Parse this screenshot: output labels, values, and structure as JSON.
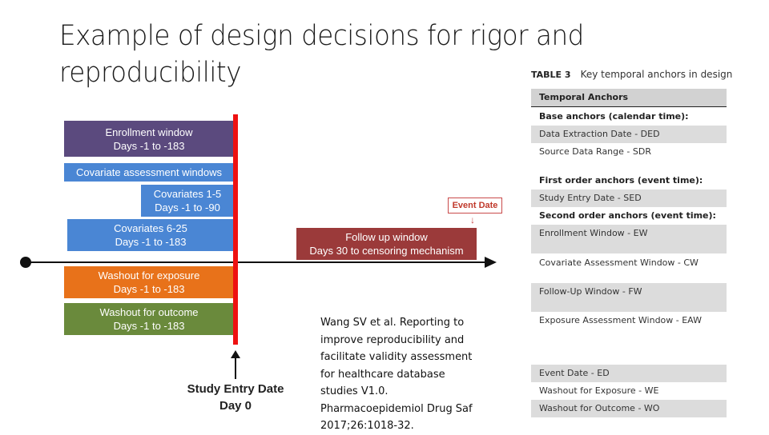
{
  "slide": {
    "title": "Example of design decisions for rigor and reproducibility"
  },
  "diagram": {
    "bars": [
      {
        "id": "enrollment",
        "line1": "Enrollment window",
        "line2": "Days -1 to -183",
        "color": "#5b4a7e"
      },
      {
        "id": "covariate-assessment",
        "line1": "Covariate assessment windows",
        "line2": "",
        "color": "#4a86d4"
      },
      {
        "id": "covariates-1-5",
        "line1": "Covariates 1-5",
        "line2": "Days -1 to -90",
        "color": "#4a86d4"
      },
      {
        "id": "covariates-6-25",
        "line1": "Covariates 6-25",
        "line2": "Days -1 to -183",
        "color": "#4a86d4"
      },
      {
        "id": "washout-exposure",
        "line1": "Washout for exposure",
        "line2": "Days -1 to -183",
        "color": "#e8721a"
      },
      {
        "id": "washout-outcome",
        "line1": "Washout for outcome",
        "line2": "Days -1 to -183",
        "color": "#6a8a3c"
      },
      {
        "id": "follow-up",
        "line1": "Follow up window",
        "line2": "Days 30 to censoring mechanism",
        "color": "#9b3a3a"
      }
    ],
    "event_date_label": "Event Date",
    "event_arrow": "↓",
    "study_entry": {
      "line1": "Study Entry Date",
      "line2": "Day 0"
    },
    "day0_line_color": "#ee1111"
  },
  "citation": {
    "lines": [
      "Wang SV et al. Reporting to",
      "improve reproducibility and",
      "facilitate validity assessment",
      "for healthcare database",
      "studies V1.0.",
      "Pharmacoepidemiol Drug Saf",
      "2017;26:1018-32."
    ]
  },
  "table": {
    "label": "TABLE 3",
    "caption": "Key temporal anchors in design",
    "header": "Temporal Anchors",
    "rows": [
      {
        "text": "Base anchors (calendar time):",
        "kind": "group"
      },
      {
        "text": "Data Extraction Date - DED",
        "kind": "shaded"
      },
      {
        "text": "Source Data Range - SDR",
        "kind": "plain"
      },
      {
        "text": "First order anchors (event time):",
        "kind": "group"
      },
      {
        "text": "Study Entry Date - SED",
        "kind": "shaded"
      },
      {
        "text": "Second order anchors (event time):",
        "kind": "group"
      },
      {
        "text": "Enrollment Window - EW",
        "kind": "shaded"
      },
      {
        "text": "Covariate Assessment Window - CW",
        "kind": "plain"
      },
      {
        "text": "Follow-Up Window - FW",
        "kind": "shaded"
      },
      {
        "text": "Exposure Assessment Window - EAW",
        "kind": "plain"
      },
      {
        "text": "Event Date - ED",
        "kind": "shaded"
      },
      {
        "text": "Washout for Exposure - WE",
        "kind": "plain"
      },
      {
        "text": "Washout for Outcome - WO",
        "kind": "shaded"
      }
    ]
  }
}
